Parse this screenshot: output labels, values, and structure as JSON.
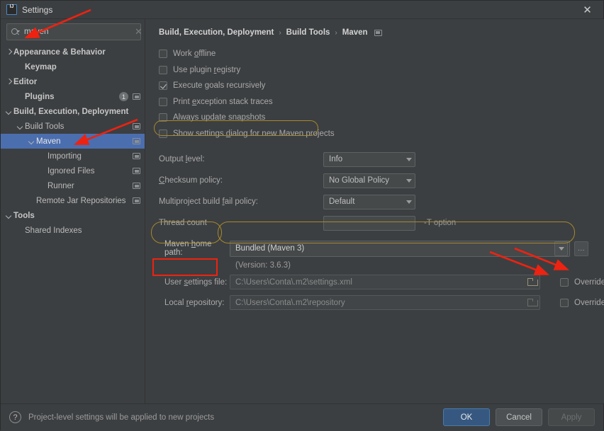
{
  "window": {
    "title": "Settings",
    "logo_icon": "intellij-idea-logo",
    "close_icon": "close-icon"
  },
  "search": {
    "value": "maven",
    "placeholder": "",
    "icon": "search-icon",
    "clear_icon": "clear-icon"
  },
  "sidebar": {
    "items": [
      {
        "label": "Appearance & Behavior",
        "indent": 0,
        "twisty": "right",
        "bold": true,
        "selected": false,
        "proj_icon": false
      },
      {
        "label": "Keymap",
        "indent": 1,
        "twisty": "none",
        "bold": true,
        "selected": false,
        "proj_icon": false
      },
      {
        "label": "Editor",
        "indent": 0,
        "twisty": "right",
        "bold": true,
        "selected": false,
        "proj_icon": false
      },
      {
        "label": "Plugins",
        "indent": 1,
        "twisty": "none",
        "bold": true,
        "selected": false,
        "proj_icon": true,
        "badge": "1"
      },
      {
        "label": "Build, Execution, Deployment",
        "indent": 0,
        "twisty": "down",
        "bold": true,
        "selected": false,
        "proj_icon": false
      },
      {
        "label": "Build Tools",
        "indent": 1,
        "twisty": "down",
        "bold": false,
        "selected": false,
        "proj_icon": true
      },
      {
        "label": "Maven",
        "indent": 2,
        "twisty": "down",
        "bold": false,
        "selected": true,
        "proj_icon": true
      },
      {
        "label": "Importing",
        "indent": 3,
        "twisty": "none",
        "bold": false,
        "selected": false,
        "proj_icon": true
      },
      {
        "label": "Ignored Files",
        "indent": 3,
        "twisty": "none",
        "bold": false,
        "selected": false,
        "proj_icon": true
      },
      {
        "label": "Runner",
        "indent": 3,
        "twisty": "none",
        "bold": false,
        "selected": false,
        "proj_icon": true
      },
      {
        "label": "Remote Jar Repositories",
        "indent": 2,
        "twisty": "none",
        "bold": false,
        "selected": false,
        "proj_icon": true
      },
      {
        "label": "Tools",
        "indent": 0,
        "twisty": "down",
        "bold": true,
        "selected": false,
        "proj_icon": false
      },
      {
        "label": "Shared Indexes",
        "indent": 1,
        "twisty": "none",
        "bold": false,
        "selected": false,
        "proj_icon": false
      }
    ]
  },
  "breadcrumb": {
    "crumbs": [
      "Build, Execution, Deployment",
      "Build Tools",
      "Maven"
    ],
    "separator": "›",
    "project_icon": "project-level-settings-icon"
  },
  "checkboxes": [
    {
      "label_pre": "Work ",
      "mnemonic": "o",
      "label_post": "ffline",
      "checked": false
    },
    {
      "label_pre": "Use plugin ",
      "mnemonic": "r",
      "label_post": "egistry",
      "checked": false
    },
    {
      "label_pre": "Execute goals recursively",
      "mnemonic": "",
      "label_post": "",
      "checked": true
    },
    {
      "label_pre": "Print ",
      "mnemonic": "e",
      "label_post": "xception stack traces",
      "checked": false
    },
    {
      "label_pre": "Always update ",
      "mnemonic": "s",
      "label_post": "napshots",
      "checked": false
    },
    {
      "label_pre": "Show settings ",
      "mnemonic": "d",
      "label_post": "ialog for new Maven projects",
      "checked": false
    }
  ],
  "form": {
    "output_level": {
      "label_pre": "Output ",
      "mnemonic": "l",
      "label_post": "evel:",
      "value": "Info"
    },
    "checksum_policy": {
      "label_pre": "",
      "mnemonic": "C",
      "label_post": "hecksum policy:",
      "value": "No Global Policy"
    },
    "multiproject_fail_policy": {
      "label_pre": "Multiproject build ",
      "mnemonic": "f",
      "label_post": "ail policy:",
      "value": "Default"
    },
    "thread_count": {
      "label": "Thread count",
      "value": "",
      "hint": "-T option"
    }
  },
  "maven_home": {
    "label_pre": "Maven ",
    "mnemonic": "h",
    "label_post": "ome path:",
    "value": "Bundled (Maven 3)",
    "version_note": "(Version: 3.6.3)",
    "browse_label": "...",
    "dropdown_icon": "chevron-down-icon"
  },
  "user_settings": {
    "label_pre": "User ",
    "mnemonic": "s",
    "label_post": "ettings file:",
    "value": "C:\\Users\\Conta\\.m2\\settings.xml",
    "folder_icon": "folder-icon",
    "override_label": "Override",
    "override_checked": false
  },
  "local_repository": {
    "label_pre": "Local ",
    "mnemonic": "r",
    "label_post": "epository:",
    "value": "C:\\Users\\Conta\\.m2\\repository",
    "folder_icon": "folder-icon",
    "override_label": "Override",
    "override_checked": false
  },
  "footer": {
    "help_icon": "help-icon",
    "status": "Project-level settings will be applied to new projects",
    "ok_label": "OK",
    "cancel_label": "Cancel",
    "apply_label": "Apply"
  },
  "annotations": {
    "highlight_color": "#a8882e",
    "callout_color": "#ee2211"
  }
}
